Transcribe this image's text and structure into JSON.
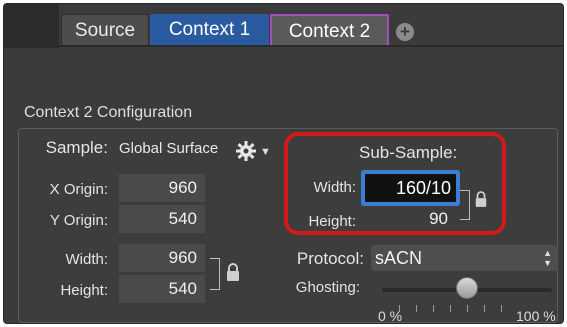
{
  "tabs": [
    {
      "label": "Source"
    },
    {
      "label": "Context 1"
    },
    {
      "label": "Context 2"
    }
  ],
  "add_tab_symbol": "+",
  "section_title": "Context 2 Configuration",
  "sample": {
    "label": "Sample:",
    "value": "Global Surface"
  },
  "origin": {
    "x_label": "X Origin:",
    "x_value": "960",
    "y_label": "Y Origin:",
    "y_value": "540"
  },
  "size": {
    "width_label": "Width:",
    "width_value": "960",
    "height_label": "Height:",
    "height_value": "540"
  },
  "subsample": {
    "title": "Sub-Sample:",
    "width_label": "Width:",
    "width_value": "160/10",
    "height_label": "Height:",
    "height_value": "90"
  },
  "protocol": {
    "label": "Protocol:",
    "value": "sACN"
  },
  "ghosting": {
    "label": "Ghosting:",
    "min_label": "0 %",
    "max_label": "100 %",
    "level_percent": 50
  },
  "colors": {
    "active_tab": "#2a5aa0",
    "selected_tab_border": "#a24fbd",
    "highlight_box": "#d11a1a",
    "focus_field": "#3a7fd4"
  }
}
